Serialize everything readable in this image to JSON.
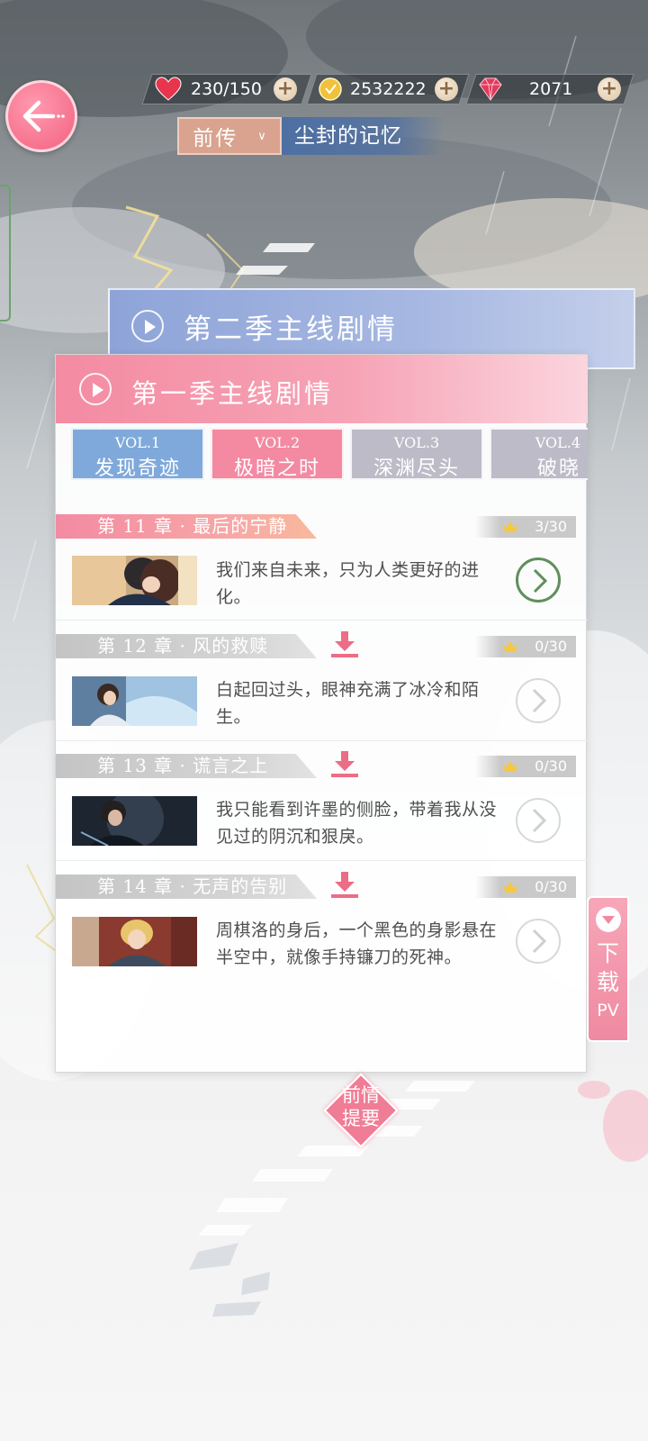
{
  "resources": {
    "stamina": {
      "icon": "heart-icon",
      "value": "230/150"
    },
    "gold": {
      "icon": "gold-coin-icon",
      "value": "2532222"
    },
    "diamond": {
      "icon": "diamond-icon",
      "value": "2071"
    }
  },
  "header": {
    "season_tab": "前传",
    "season_subtitle": "尘封的记忆"
  },
  "season2": {
    "title": "第二季主线剧情"
  },
  "season1": {
    "title": "第一季主线剧情",
    "volumes": [
      {
        "num": "VOL.1",
        "name": "发现奇迹",
        "color": "#7fa9da"
      },
      {
        "num": "VOL.2",
        "name": "极暗之时",
        "color": "#f38aa2"
      },
      {
        "num": "VOL.3",
        "name": "深渊尽头",
        "color": "#bdbbc8"
      },
      {
        "num": "VOL.4",
        "name": "破晓",
        "color": "#bdbbc8"
      }
    ],
    "chapters": [
      {
        "title": "第 11 章 · 最后的宁静",
        "progress": "3/30",
        "desc": "我们来自未来，只为人类更好的进化。",
        "unlocked": true
      },
      {
        "title": "第 12 章 · 风的救赎",
        "progress": "0/30",
        "desc": "白起回过头，眼神充满了冰冷和陌生。",
        "unlocked": false
      },
      {
        "title": "第 13 章 · 谎言之上",
        "progress": "0/30",
        "desc": "我只能看到许墨的侧脸，带着我从没见过的阴沉和狠戾。",
        "unlocked": false
      },
      {
        "title": "第 14 章 · 无声的告别",
        "progress": "0/30",
        "desc": "周棋洛的身后，一个黑色的身影悬在半空中，就像手持镰刀的死神。",
        "unlocked": false
      }
    ]
  },
  "download_pv": {
    "line1": "下",
    "line2": "载",
    "line3": "PV"
  },
  "recap": {
    "line1": "前情",
    "line2": "提要"
  },
  "colors": {
    "accent": "#f38aa2",
    "season2": "#8ea4d8",
    "locked": "#c9c9c9"
  }
}
